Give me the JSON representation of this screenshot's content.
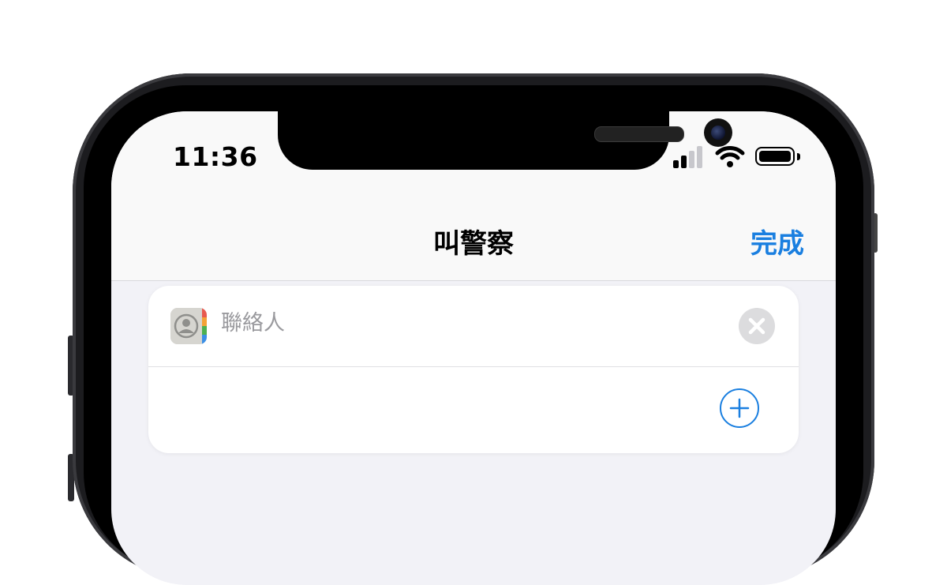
{
  "status_bar": {
    "time": "11:36",
    "signal_icon": "cellular-signal-icon",
    "wifi_icon": "wifi-icon",
    "battery_icon": "battery-icon",
    "battery_level": 1.0
  },
  "nav": {
    "title": "叫警察",
    "done_label": "完成"
  },
  "card": {
    "contact_icon": "contacts-app-icon",
    "contact_placeholder": "聯絡人",
    "clear_icon": "clear-x-icon",
    "add_icon": "add-plus-icon"
  },
  "colors": {
    "accent": "#1a7fe0",
    "background": "#f2f2f7",
    "placeholder": "#9a9a9e"
  }
}
